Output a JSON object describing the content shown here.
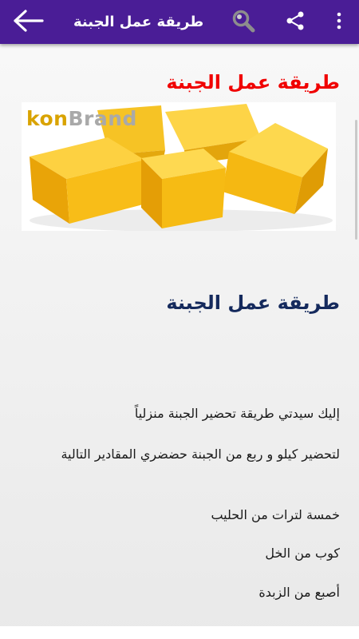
{
  "app_bar": {
    "title": "طريقة عمل الجبنة",
    "back_icon": "arrow-back-icon",
    "search_icon": "search-icon",
    "share_icon": "share-icon",
    "more_icon": "more-vert-icon",
    "color": "#4a1d96"
  },
  "article": {
    "title": "طريقة عمل الجبنة",
    "title_color": "#f00000",
    "image_watermark_prefix": "kon",
    "image_watermark_suffix": "Brand",
    "heading": "طريقة عمل الجبنة",
    "heading_color": "#152a5d",
    "paragraphs": [
      "إليك سيدتي طريقة تحضير الجبنة منزلياً",
      "لتحضير كيلو و ربع من الجبنة حضضري المقادير التالية",
      "خمسة لترات من الحليب",
      "كوب من الخل",
      "أصبع من الزبدة"
    ]
  }
}
